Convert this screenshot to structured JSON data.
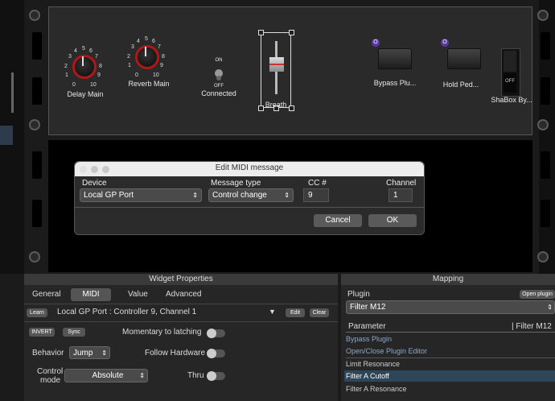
{
  "rack": {
    "knob1": {
      "label": "Delay Main",
      "ticks": [
        "0",
        "1",
        "2",
        "3",
        "4",
        "5",
        "6",
        "7",
        "8",
        "9",
        "10"
      ]
    },
    "knob2": {
      "label": "Reverb Main",
      "ticks": [
        "0",
        "1",
        "2",
        "3",
        "4",
        "5",
        "6",
        "7",
        "8",
        "9",
        "10"
      ]
    },
    "toggle": {
      "on": "ON",
      "off": "OFF",
      "label": "Connected"
    },
    "fader": {
      "label": "Breath"
    },
    "pedal1": {
      "badge": "O",
      "label": "Bypass Plu..."
    },
    "pedal2": {
      "badge": "O",
      "label": "Hold Ped..."
    },
    "switch": {
      "state": "OFF",
      "label": "ShaBox By..."
    }
  },
  "dialog": {
    "title": "Edit MIDI message",
    "device_label": "Device",
    "device_value": "Local GP Port",
    "msgtype_label": "Message type",
    "msgtype_value": "Control change",
    "cc_label": "CC #",
    "cc_value": "9",
    "channel_label": "Channel",
    "channel_value": "1",
    "cancel": "Cancel",
    "ok": "OK"
  },
  "widget": {
    "title": "Widget Properties",
    "tabs": [
      "General",
      "MIDI",
      "Value",
      "Advanced"
    ],
    "learn": "Learn",
    "mapping_text": "Local GP Port : Controller 9, Channel 1",
    "edit": "Edit",
    "clear": "Clear",
    "invert": "INVERT",
    "sync": "Sync",
    "momentary": "Momentary to latching",
    "behavior_label": "Behavior",
    "behavior_value": "Jump",
    "follow": "Follow Hardware",
    "control_mode_label1": "Control",
    "control_mode_label2": "mode",
    "control_mode_value": "Absolute",
    "thru": "Thru"
  },
  "mapping": {
    "title": "Mapping",
    "plugin_label": "Plugin",
    "open_plugin": "Open plugin",
    "plugin_value": "Filter M12",
    "parameter_label": "Parameter",
    "parameter_col2": "| Filter M12",
    "params": [
      "Bypass Plugin",
      "Open/Close Plugin Editor",
      "Limit Resonance",
      "Filter A  Cutoff",
      "Filter A  Resonance"
    ]
  }
}
